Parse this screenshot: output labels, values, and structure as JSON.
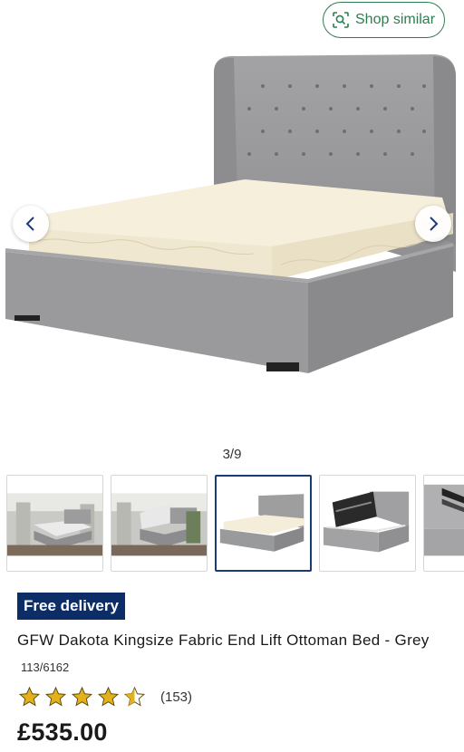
{
  "shop_similar": {
    "label": "Shop similar",
    "icon": "visual-search-icon"
  },
  "gallery": {
    "counter": "3/9",
    "prev_icon": "chevron-left-icon",
    "next_icon": "chevron-right-icon",
    "thumbnails": [
      {
        "name": "thumb-1",
        "active": false
      },
      {
        "name": "thumb-2",
        "active": false
      },
      {
        "name": "thumb-3",
        "active": true
      },
      {
        "name": "thumb-4",
        "active": false
      },
      {
        "name": "thumb-5",
        "active": false
      }
    ]
  },
  "badge": {
    "label": "Free delivery",
    "color": "#0d2d66"
  },
  "product": {
    "title": "GFW Dakota Kingsize Fabric End Lift Ottoman Bed - Grey",
    "product_id": "113/6162",
    "rating": 4.5,
    "review_count": "(153)",
    "price": "£535.00"
  },
  "colors": {
    "accent_green": "#2e7d4f",
    "star_gold": "#e3b21b",
    "navy": "#0d2d66"
  }
}
